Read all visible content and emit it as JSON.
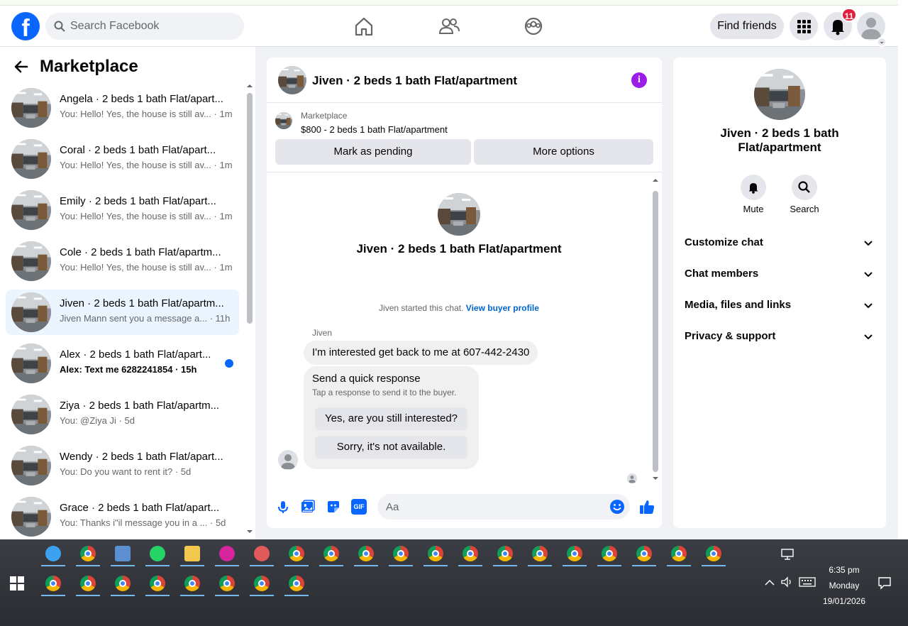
{
  "header": {
    "logo_letter": "f",
    "search_placeholder": "Search Facebook",
    "find_friends": "Find friends",
    "notification_count": "11"
  },
  "sidebar": {
    "title": "Marketplace",
    "conversations": [
      {
        "name": "Angela · 2 beds 1 bath Flat/apart...",
        "preview": "You: Hello! Yes, the house is still av... · 1m",
        "unread": false,
        "active": false
      },
      {
        "name": "Coral · 2 beds 1 bath Flat/apart...",
        "preview": "You: Hello! Yes, the house is still av... · 1m",
        "unread": false,
        "active": false
      },
      {
        "name": "Emily · 2 beds 1 bath Flat/apart...",
        "preview": "You: Hello! Yes, the house is still av... · 1m",
        "unread": false,
        "active": false
      },
      {
        "name": "Cole · 2 beds 1 bath Flat/apartm...",
        "preview": "You: Hello! Yes, the house is still av... · 1m",
        "unread": false,
        "active": false
      },
      {
        "name": "Jiven · 2 beds 1 bath Flat/apartm...",
        "preview": "Jiven Mann sent you a message a... · 11h",
        "unread": false,
        "active": true
      },
      {
        "name": "Alex · 2 beds 1 bath Flat/apart...",
        "preview": "Alex: Text me 6282241854 · 15h",
        "unread": true,
        "active": false
      },
      {
        "name": "Ziya · 2 beds 1 bath Flat/apartm...",
        "preview": "You: @Ziya Ji · 5d",
        "unread": false,
        "active": false
      },
      {
        "name": "Wendy · 2 beds 1 bath Flat/apart...",
        "preview": "You: Do you want to rent it? · 5d",
        "unread": false,
        "active": false
      },
      {
        "name": "Grace · 2 beds 1 bath Flat/apart...",
        "preview": "You: Thanks i\"il message you in a ... · 5d",
        "unread": false,
        "active": false
      }
    ]
  },
  "chat": {
    "title": "Jiven · 2 beds 1 bath Flat/apartment",
    "listing_label": "Marketplace",
    "listing_price": "$800 - 2 beds 1 bath Flat/apartment",
    "mark_pending": "Mark as pending",
    "more_options": "More options",
    "started_text": "Jiven started this chat.",
    "view_buyer": "View buyer profile",
    "sender_name": "Jiven",
    "message": "I'm interested get back to me at 607-442-2430",
    "quick_title": "Send a quick response",
    "quick_sub": "Tap a response to send it to the buyer.",
    "quick_1": "Yes, are you still interested?",
    "quick_2": "Sorry, it's not available.",
    "composer_placeholder": "Aa",
    "gif_label": "GIF"
  },
  "details": {
    "title": "Jiven · 2 beds 1 bath Flat/apartment",
    "mute": "Mute",
    "search": "Search",
    "sections": [
      "Customize chat",
      "Chat members",
      "Media, files and links",
      "Privacy & support"
    ]
  },
  "taskbar": {
    "time": "6:35 pm",
    "day": "Monday",
    "date": "19/01/2026",
    "apps_row1": [
      "dropbox-icon",
      "chrome-icon",
      "calculator-icon",
      "whatsapp-icon",
      "file-explorer-icon",
      "instagram-icon",
      "paint-icon",
      "chrome-profile-icon",
      "chrome-profile-icon",
      "chrome-profile-icon",
      "chrome-profile-icon",
      "chrome-profile-icon",
      "chrome-profile-icon",
      "chrome-profile-icon",
      "chrome-profile-icon",
      "chrome-profile-icon",
      "chrome-profile-icon",
      "chrome-profile-icon",
      "chrome-profile-icon",
      "chrome-profile-icon"
    ],
    "apps_row2": [
      "chrome-profile-icon",
      "chrome-profile-icon",
      "chrome-profile-icon",
      "chrome-profile-icon",
      "chrome-profile-icon",
      "chrome-profile-icon",
      "chrome-profile-icon",
      "chrome-profile-icon"
    ]
  },
  "colors": {
    "brand": "#0866ff",
    "link": "#0064d1",
    "info": "#9c1de7",
    "badge": "#e41e3f"
  }
}
